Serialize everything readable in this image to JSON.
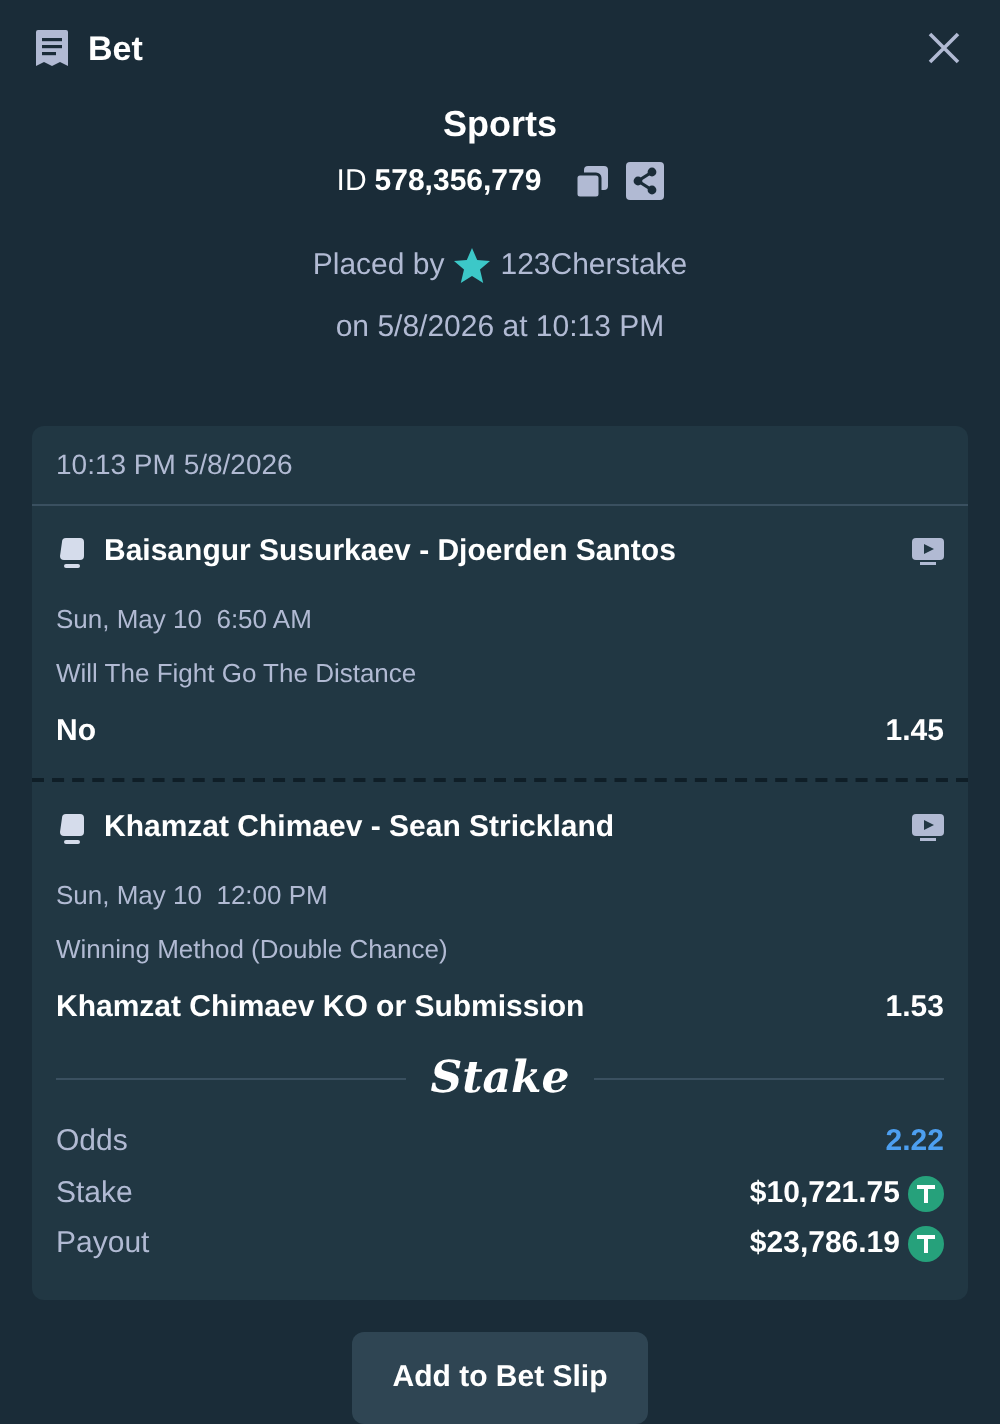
{
  "header": {
    "title": "Bet"
  },
  "summary": {
    "category": "Sports",
    "id_label": "ID",
    "id_value": "578,356,779",
    "placed_by": "Placed by",
    "user": "123Cherstake",
    "placed_on": "on 5/8/2026 at 10:13 PM"
  },
  "slip": {
    "timestamp": "10:13 PM 5/8/2026",
    "legs": [
      {
        "event": "Baisangur Susurkaev - Djoerden Santos",
        "date": "Sun, May 10  6:50 AM",
        "market": "Will The Fight Go The Distance",
        "outcome": "No",
        "odds": "1.45"
      },
      {
        "event": "Khamzat Chimaev - Sean Strickland",
        "date": "Sun, May 10  12:00 PM",
        "market": "Winning Method (Double Chance)",
        "outcome": "Khamzat Chimaev KO or Submission",
        "odds": "1.53"
      }
    ],
    "brand": "Stake",
    "totals": [
      {
        "kind": "odds",
        "label": "Odds",
        "value": "2.22"
      },
      {
        "kind": "money",
        "label": "Stake",
        "value": "$10,721.75"
      },
      {
        "kind": "money",
        "label": "Payout",
        "value": "$23,786.19"
      }
    ]
  },
  "buttons": [
    "Add to Bet Slip"
  ]
}
